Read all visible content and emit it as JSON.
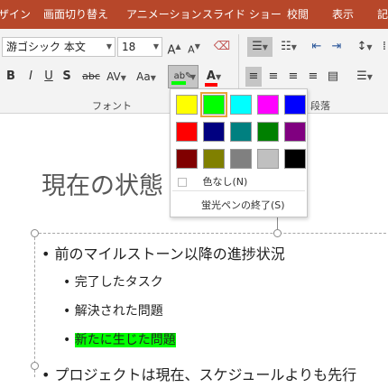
{
  "tabs": [
    "ザイン",
    "画面切り替え",
    "アニメーション",
    "スライド ショー",
    "校閲",
    "表示",
    "記"
  ],
  "font": {
    "name": "游ゴシック 本文",
    "size": "18",
    "group_label": "フォント"
  },
  "paragraph": {
    "group_label": "段落"
  },
  "highlight_menu": {
    "colors": [
      [
        "#ffff00",
        "#00ff00",
        "#00ffff",
        "#ff00ff",
        "#0000ff"
      ],
      [
        "#ff0000",
        "#000080",
        "#008080",
        "#008000",
        "#800080"
      ],
      [
        "#800000",
        "#808000",
        "#808080",
        "#c0c0c0",
        "#000000"
      ]
    ],
    "selected": "#00ff00",
    "no_color_label": "色なし(N)",
    "stop_label": "蛍光ペンの終了(S)"
  },
  "slide": {
    "title": "現在の状態",
    "bullets": [
      "前のマイルストーン以降の進捗状況",
      "完了したタスク",
      "解決された問題",
      "新たに生じた問題",
      "プロジェクトは現在、スケジュールよりも先行"
    ]
  }
}
